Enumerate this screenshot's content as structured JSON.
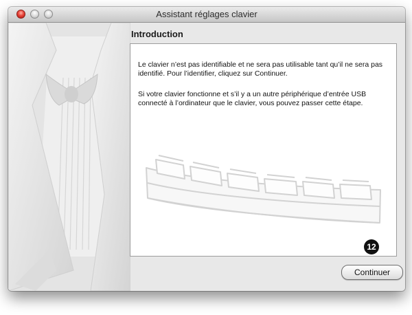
{
  "window": {
    "title": "Assistant réglages clavier"
  },
  "main": {
    "heading": "Introduction",
    "paragraphs": [
      "Le clavier n’est pas identifiable et ne sera pas utilisable tant qu’il ne sera pas identifié. Pour l’identifier, cliquez sur Continuer.",
      "Si votre clavier fonctionne et s’il y a un autre périphérique d’entrée USB connecté à l’ordinateur que le clavier, vous pouvez passer cette étape."
    ],
    "keyboard_icon": "keyboard-illustration"
  },
  "callout": {
    "number": "12"
  },
  "buttons": {
    "continue_label": "Continuer"
  },
  "colors": {
    "close_button": "#e8453a",
    "window_background": "#e6e6e6",
    "panel_background": "#ffffff"
  }
}
